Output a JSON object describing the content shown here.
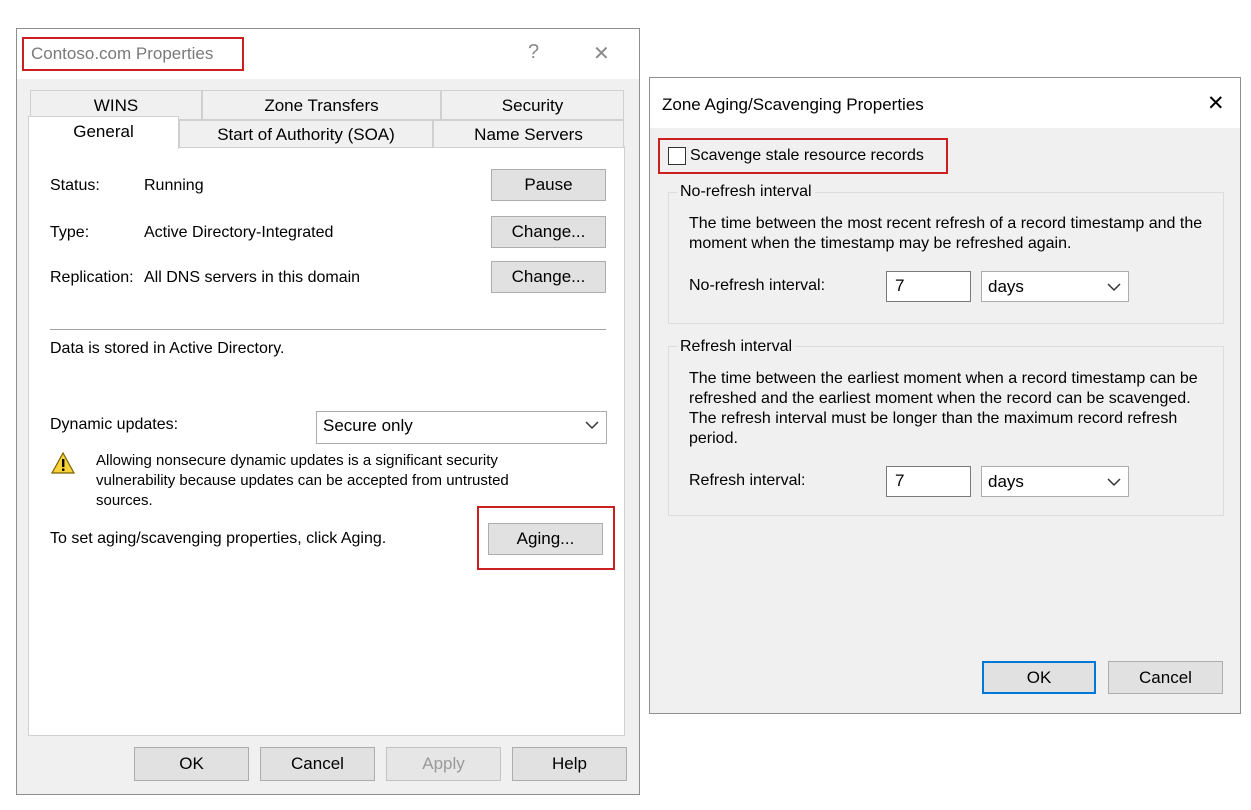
{
  "left_dialog": {
    "title": "Contoso.com Properties",
    "help_glyph": "?",
    "close_glyph": "✕",
    "tabs_row1": [
      "WINS",
      "Zone Transfers",
      "Security"
    ],
    "tabs_row2": [
      "General",
      "Start of Authority (SOA)",
      "Name Servers"
    ],
    "status_label": "Status:",
    "status_value": "Running",
    "pause_button": "Pause",
    "type_label": "Type:",
    "type_value": "Active Directory-Integrated",
    "type_change_button": "Change...",
    "replication_label": "Replication:",
    "replication_value": "All DNS servers in this domain",
    "replication_change_button": "Change...",
    "storage_text": "Data is stored in Active Directory.",
    "dynamic_updates_label": "Dynamic updates:",
    "dynamic_updates_value": "Secure only",
    "warning_text": "Allowing nonsecure dynamic updates is a significant security vulnerability because updates can be accepted from untrusted sources.",
    "aging_hint": "To set aging/scavenging properties, click Aging.",
    "aging_button": "Aging...",
    "ok_button": "OK",
    "cancel_button": "Cancel",
    "apply_button": "Apply",
    "help_button": "Help"
  },
  "right_dialog": {
    "title": "Zone Aging/Scavenging Properties",
    "close_glyph": "✕",
    "scavenge_checkbox_label": "Scavenge stale resource records",
    "scavenge_checked": false,
    "no_refresh_group": {
      "legend": "No-refresh interval",
      "description": "The time between the most recent refresh of a record timestamp and the moment when the timestamp may be refreshed again.",
      "field_label": "No-refresh interval:",
      "value": "7",
      "unit": "days"
    },
    "refresh_group": {
      "legend": "Refresh interval",
      "description": "The time between the earliest moment when a record timestamp can be refreshed and the earliest moment when the record can be scavenged. The refresh interval must be longer than the maximum record refresh period.",
      "field_label": "Refresh interval:",
      "value": "7",
      "unit": "days"
    },
    "ok_button": "OK",
    "cancel_button": "Cancel"
  },
  "colors": {
    "highlight_red": "#cc1f1f",
    "default_button_blue": "#0078d7",
    "dialog_bg": "#f0f0f0"
  },
  "icons": [
    "warning-icon",
    "chevron-down-icon",
    "close-icon",
    "help-icon"
  ]
}
